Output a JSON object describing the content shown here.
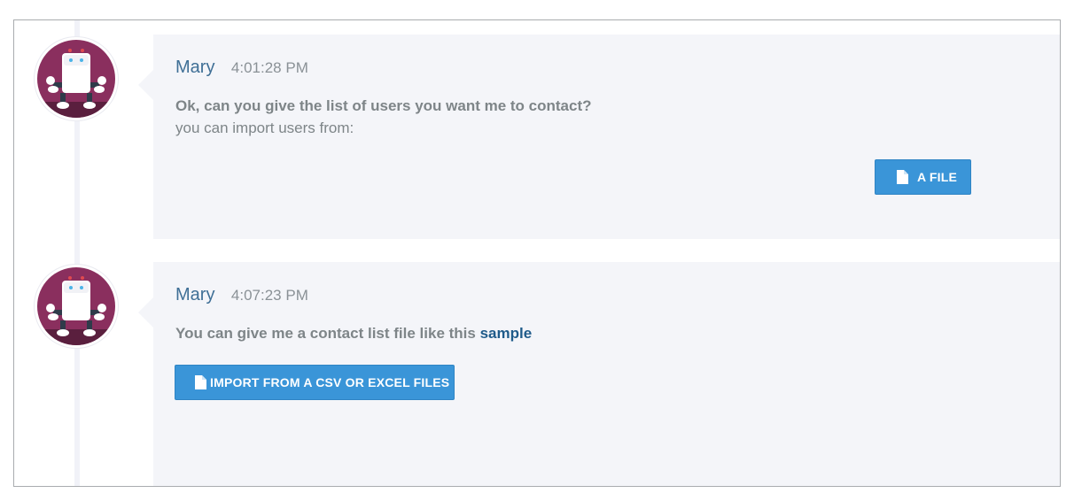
{
  "messages": [
    {
      "sender": "Mary",
      "time": "4:01:28 PM",
      "text_bold": "Ok, can you give the list of users you want me to contact?",
      "text": "you can import users from:",
      "button": {
        "label": "A FILE",
        "icon": "file-icon"
      }
    },
    {
      "sender": "Mary",
      "time": "4:07:23 PM",
      "text_bold": "You can give me a contact list file like this ",
      "link": "sample",
      "button": {
        "label": "IMPORT FROM A CSV OR EXCEL FILES",
        "icon": "file-icon"
      }
    }
  ],
  "colors": {
    "button": "#3a95d8",
    "sender": "#3f6f96",
    "bubble": "#f4f5f9",
    "avatar": "#8a2f5e"
  }
}
